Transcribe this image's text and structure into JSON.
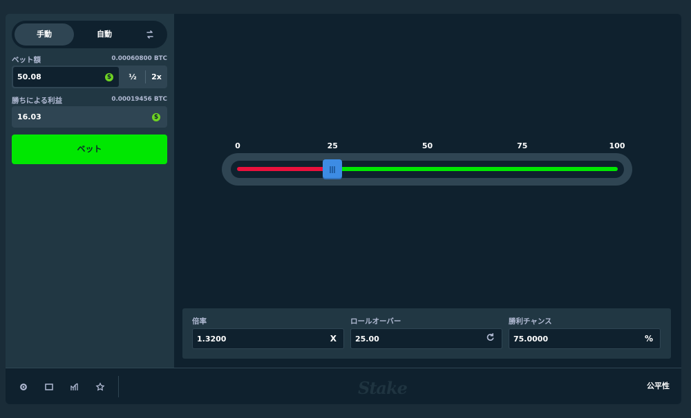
{
  "mode": {
    "manual_label": "手動",
    "auto_label": "自動",
    "swap_icon": "swap-arrows-icon"
  },
  "bet_amount": {
    "label": "ベット額",
    "btc_value": "0.00060800 BTC",
    "value": "50.08",
    "currency_icon": "dollar-coin-icon",
    "half_label": "½",
    "double_label": "2x"
  },
  "profit_on_win": {
    "label": "勝ちによる利益",
    "btc_value": "0.00019456 BTC",
    "value": "16.03",
    "currency_icon": "dollar-coin-icon"
  },
  "bet_button": {
    "label": "ベット"
  },
  "slider": {
    "ticks": [
      "0",
      "25",
      "50",
      "75",
      "100"
    ],
    "value": 25,
    "min": 0,
    "max": 100,
    "lose_color": "#e9113c",
    "win_color": "#00e701",
    "handle_color": "#3d8ce4"
  },
  "stats": {
    "multiplier": {
      "label": "倍率",
      "value": "1.3200",
      "suffix": "X"
    },
    "roll_over": {
      "label": "ロールオーバー",
      "value": "25.00",
      "icon": "refresh-icon"
    },
    "win_chance": {
      "label": "勝利チャンス",
      "value": "75.0000",
      "suffix": "%"
    }
  },
  "footer": {
    "icons": [
      "gear-icon",
      "theatre-mode-icon",
      "stats-chart-icon",
      "star-icon"
    ],
    "logo_text": "Stake",
    "fairness_label": "公平性"
  },
  "colors": {
    "bg": "#1a2c38",
    "panel": "#213743",
    "dark": "#0f212e",
    "accent_green": "#00e701",
    "blue": "#3d8ce4",
    "red": "#e9113c"
  }
}
